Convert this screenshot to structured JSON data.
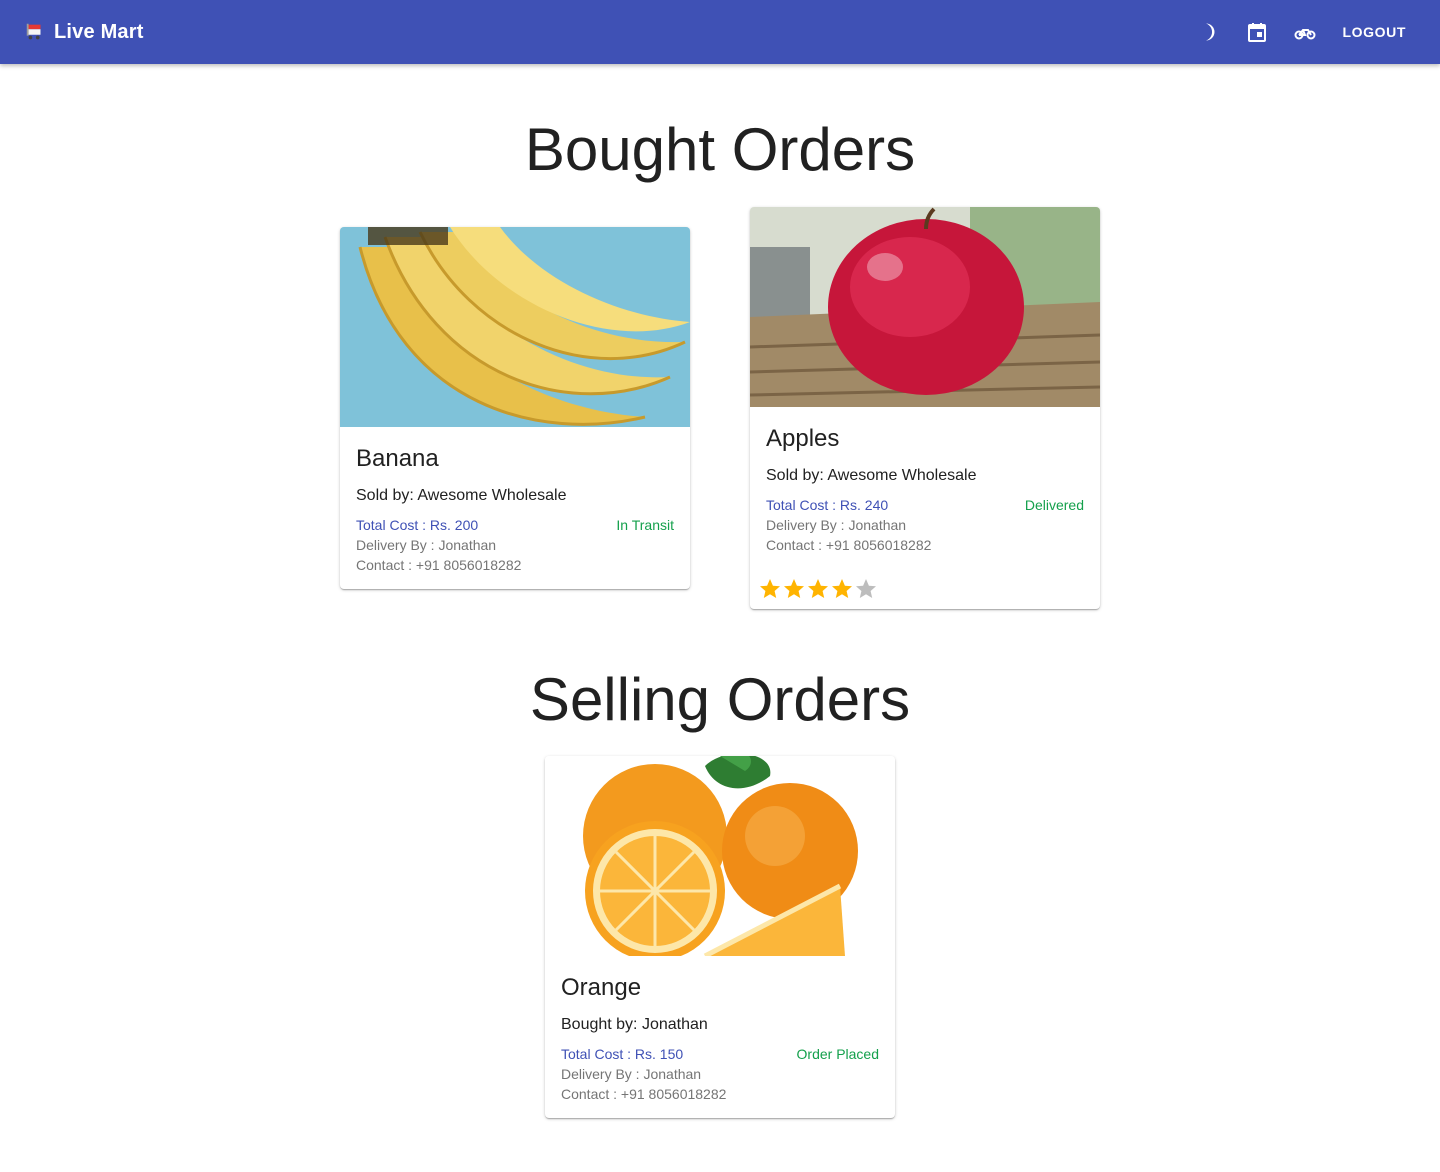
{
  "appbar": {
    "title": "Live Mart",
    "logo_icon": "cart-icon",
    "icons": [
      "dark-mode-icon",
      "calendar-icon",
      "bike-icon"
    ],
    "logout_label": "LOGOUT",
    "color": "#3f51b5"
  },
  "sections": {
    "bought_title": "Bought Orders",
    "selling_title": "Selling Orders"
  },
  "bought_orders": [
    {
      "name": "Banana",
      "party": "Sold by: Awesome Wholesale",
      "cost": "Total Cost : Rs. 200",
      "status": "In Transit",
      "delivery": "Delivery By : Jonathan",
      "contact": "Contact : +91 8056018282"
    },
    {
      "name": "Apples",
      "party": "Sold by: Awesome Wholesale",
      "cost": "Total Cost : Rs. 240",
      "status": "Delivered",
      "delivery": "Delivery By : Jonathan",
      "contact": "Contact : +91 8056018282",
      "rating": 4,
      "rating_max": 5
    }
  ],
  "selling_orders": [
    {
      "name": "Orange",
      "party": "Bought by: Jonathan",
      "cost": "Total Cost : Rs. 150",
      "status": "Order Placed",
      "delivery": "Delivery By : Jonathan",
      "contact": "Contact : +91 8056018282"
    }
  ],
  "colors": {
    "cost": "#3f51b5",
    "status": "#14a04c",
    "star_filled": "#ffb400",
    "star_empty": "#bdbdbd"
  }
}
